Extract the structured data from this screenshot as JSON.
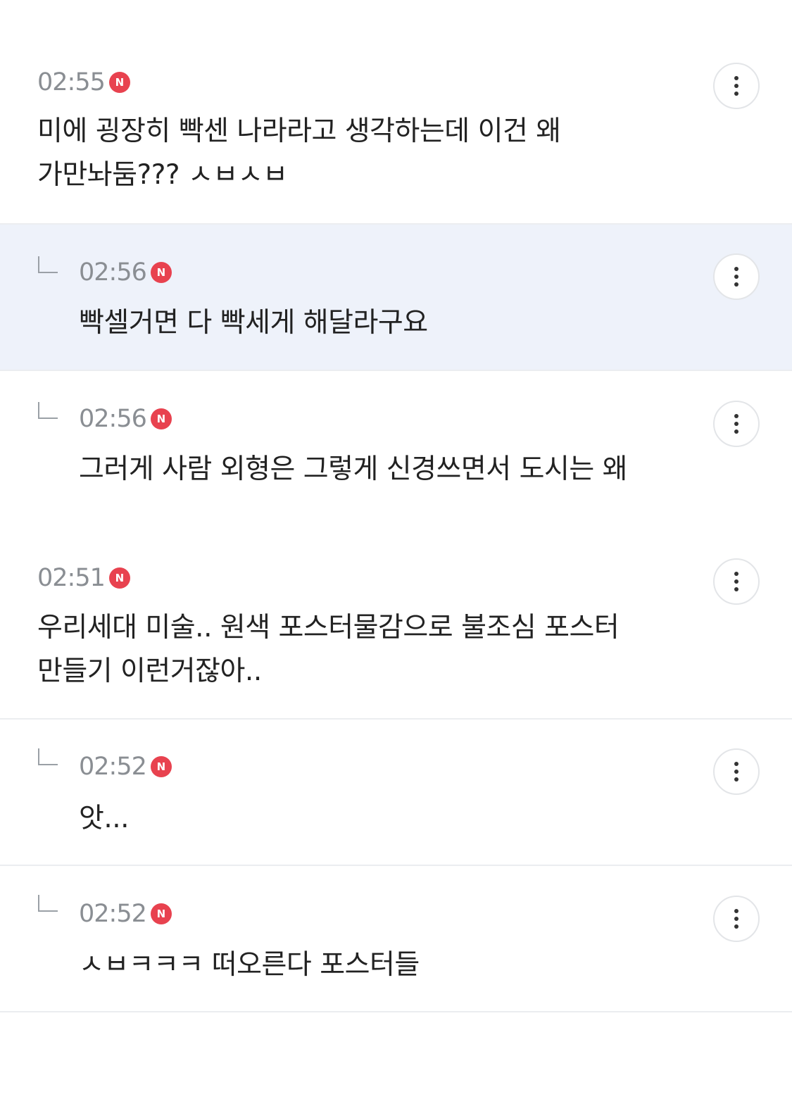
{
  "badge_label": "N",
  "colors": {
    "badge": "#e8424f",
    "timestamp": "#8a8e93",
    "highlight_bg": "#eef2fa",
    "divider": "#ebedf0"
  },
  "comments": [
    {
      "time": "02:55",
      "is_reply": false,
      "highlighted": false,
      "text": "미에 굉장히 빡센 나라라고 생각하는데 이건 왜\n가만놔둠??? ㅅㅂㅅㅂ"
    },
    {
      "time": "02:56",
      "is_reply": true,
      "highlighted": true,
      "text": "빡셀거면 다 빡세게 해달라구요"
    },
    {
      "time": "02:56",
      "is_reply": true,
      "highlighted": false,
      "text": "그러게 사람 외형은 그렇게 신경쓰면서 도시는 왜"
    },
    {
      "time": "02:51",
      "is_reply": false,
      "highlighted": false,
      "text": "우리세대 미술.. 원색 포스터물감으로 불조심 포스터\n만들기 이런거잖아.."
    },
    {
      "time": "02:52",
      "is_reply": true,
      "highlighted": false,
      "text": "앗..."
    },
    {
      "time": "02:52",
      "is_reply": true,
      "highlighted": false,
      "text": "ㅅㅂㅋㅋㅋ 떠오른다 포스터들"
    }
  ]
}
